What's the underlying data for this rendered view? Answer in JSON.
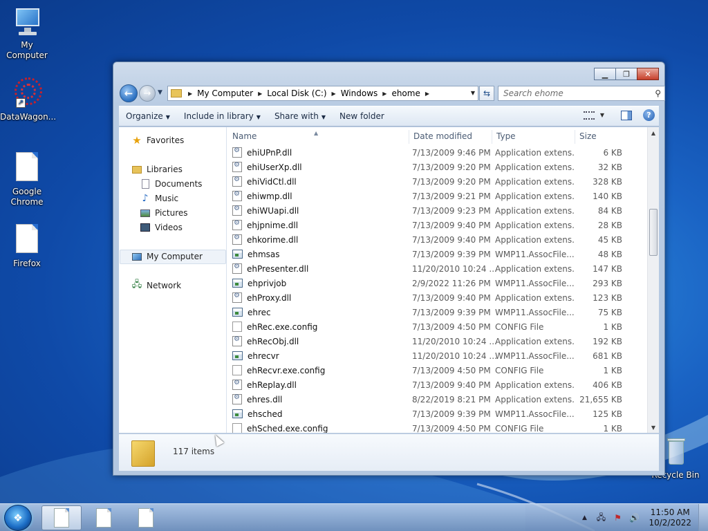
{
  "desktop": {
    "icons": [
      {
        "label": "My Computer",
        "icon": "computer-icon"
      },
      {
        "label": "DataWagon...",
        "icon": "datawagon-icon"
      },
      {
        "label": "Google Chrome",
        "icon": "document-icon"
      },
      {
        "label": "Firefox",
        "icon": "document-icon"
      },
      {
        "label": "Recycle Bin",
        "icon": "recycle-bin-icon"
      }
    ]
  },
  "window": {
    "address": {
      "crumbs": [
        "My Computer",
        "Local Disk (C:)",
        "Windows",
        "ehome"
      ]
    },
    "search": {
      "placeholder": "Search ehome"
    },
    "toolbar": {
      "organize": "Organize",
      "include": "Include in library",
      "share": "Share with",
      "new_folder": "New folder"
    },
    "navpane": {
      "favorites": "Favorites",
      "libraries": "Libraries",
      "documents": "Documents",
      "music": "Music",
      "pictures": "Pictures",
      "videos": "Videos",
      "my_computer": "My Computer",
      "network": "Network"
    },
    "columns": {
      "name": "Name",
      "date": "Date modified",
      "type": "Type",
      "size": "Size"
    },
    "files": [
      {
        "name": "ehiUPnP.dll",
        "date": "7/13/2009 9:46 PM",
        "type": "Application extens...",
        "size": "6 KB",
        "kind": "dll"
      },
      {
        "name": "ehiUserXp.dll",
        "date": "7/13/2009 9:20 PM",
        "type": "Application extens...",
        "size": "32 KB",
        "kind": "dll"
      },
      {
        "name": "ehiVidCtl.dll",
        "date": "7/13/2009 9:20 PM",
        "type": "Application extens...",
        "size": "328 KB",
        "kind": "dll"
      },
      {
        "name": "ehiwmp.dll",
        "date": "7/13/2009 9:21 PM",
        "type": "Application extens...",
        "size": "140 KB",
        "kind": "dll"
      },
      {
        "name": "ehiWUapi.dll",
        "date": "7/13/2009 9:23 PM",
        "type": "Application extens...",
        "size": "84 KB",
        "kind": "dll"
      },
      {
        "name": "ehjpnime.dll",
        "date": "7/13/2009 9:40 PM",
        "type": "Application extens...",
        "size": "28 KB",
        "kind": "dll"
      },
      {
        "name": "ehkorime.dll",
        "date": "7/13/2009 9:40 PM",
        "type": "Application extens...",
        "size": "45 KB",
        "kind": "dll"
      },
      {
        "name": "ehmsas",
        "date": "7/13/2009 9:39 PM",
        "type": "WMP11.AssocFile....",
        "size": "48 KB",
        "kind": "wmp"
      },
      {
        "name": "ehPresenter.dll",
        "date": "11/20/2010 10:24 ...",
        "type": "Application extens...",
        "size": "147 KB",
        "kind": "dll"
      },
      {
        "name": "ehprivjob",
        "date": "2/9/2022 11:26 PM",
        "type": "WMP11.AssocFile....",
        "size": "293 KB",
        "kind": "wmp"
      },
      {
        "name": "ehProxy.dll",
        "date": "7/13/2009 9:40 PM",
        "type": "Application extens...",
        "size": "123 KB",
        "kind": "dll"
      },
      {
        "name": "ehrec",
        "date": "7/13/2009 9:39 PM",
        "type": "WMP11.AssocFile....",
        "size": "75 KB",
        "kind": "wmp"
      },
      {
        "name": "ehRec.exe.config",
        "date": "7/13/2009 4:50 PM",
        "type": "CONFIG File",
        "size": "1 KB",
        "kind": "cfg"
      },
      {
        "name": "ehRecObj.dll",
        "date": "11/20/2010 10:24 ...",
        "type": "Application extens...",
        "size": "192 KB",
        "kind": "dll"
      },
      {
        "name": "ehrecvr",
        "date": "11/20/2010 10:24 ...",
        "type": "WMP11.AssocFile....",
        "size": "681 KB",
        "kind": "wmp"
      },
      {
        "name": "ehRecvr.exe.config",
        "date": "7/13/2009 4:50 PM",
        "type": "CONFIG File",
        "size": "1 KB",
        "kind": "cfg"
      },
      {
        "name": "ehReplay.dll",
        "date": "7/13/2009 9:40 PM",
        "type": "Application extens...",
        "size": "406 KB",
        "kind": "dll"
      },
      {
        "name": "ehres.dll",
        "date": "8/22/2019 8:21 PM",
        "type": "Application extens...",
        "size": "21,655 KB",
        "kind": "dll"
      },
      {
        "name": "ehsched",
        "date": "7/13/2009 9:39 PM",
        "type": "WMP11.AssocFile....",
        "size": "125 KB",
        "kind": "wmp"
      },
      {
        "name": "ehSched.exe.config",
        "date": "7/13/2009 4:50 PM",
        "type": "CONFIG File",
        "size": "1 KB",
        "kind": "cfg"
      }
    ],
    "status": {
      "item_count": "117 items"
    }
  },
  "taskbar": {
    "clock_time": "11:50 AM",
    "clock_date": "10/2/2022"
  }
}
